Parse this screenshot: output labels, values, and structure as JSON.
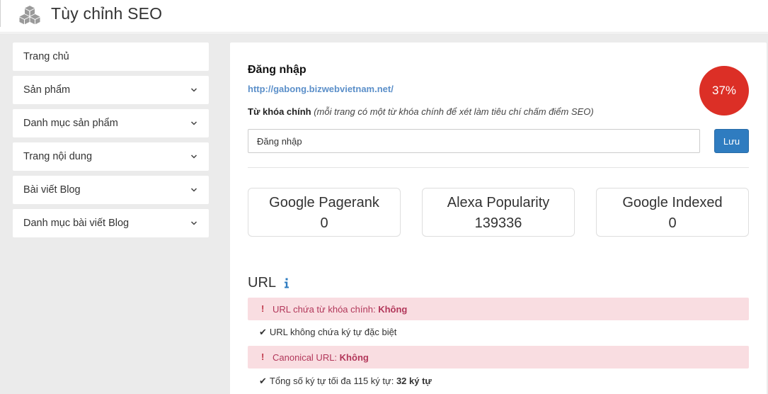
{
  "header": {
    "title": "Tùy chỉnh SEO",
    "logo_icon": "cubes-icon"
  },
  "sidebar": {
    "items": [
      {
        "label": "Trang chủ",
        "has_chevron": false
      },
      {
        "label": "Sản phẩm",
        "has_chevron": true
      },
      {
        "label": "Danh mục sản phẩm",
        "has_chevron": true
      },
      {
        "label": "Trang nội dung",
        "has_chevron": true
      },
      {
        "label": "Bài viết Blog",
        "has_chevron": true
      },
      {
        "label": "Danh mục bài viết Blog",
        "has_chevron": true
      }
    ]
  },
  "page": {
    "name": "Đăng nhập",
    "url": "http://gabong.bizwebvietnam.net/",
    "keyword_label": "Từ khóa chính",
    "keyword_hint": "(mỗi trang có một từ khóa chính để xét làm tiêu chí chấm điểm SEO)",
    "keyword_value": "Đăng nhập",
    "save_label": "Lưu",
    "score": "37%"
  },
  "stats": [
    {
      "name": "Google Pagerank",
      "value": "0"
    },
    {
      "name": "Alexa Popularity",
      "value": "139336"
    },
    {
      "name": "Google Indexed",
      "value": "0"
    }
  ],
  "url_section": {
    "heading": "URL",
    "checks": [
      {
        "status": "fail",
        "text": "URL chứa từ khóa chính:",
        "result": "Không"
      },
      {
        "status": "pass",
        "text": "URL không chứa ký tự đặc biệt",
        "result": ""
      },
      {
        "status": "fail",
        "text": "Canonical URL:",
        "result": "Không"
      },
      {
        "status": "pass",
        "text": "Tổng số ký tự tối đa 115 ký tự:",
        "result": "32 ký tự"
      }
    ]
  },
  "colors": {
    "score_bg": "#dc2f26",
    "button_bg": "#2f7cc0",
    "link": "#5b8fc9",
    "alert_bg": "#f9dde1",
    "alert_text": "#b2375a",
    "page_bg": "#ebebeb"
  }
}
